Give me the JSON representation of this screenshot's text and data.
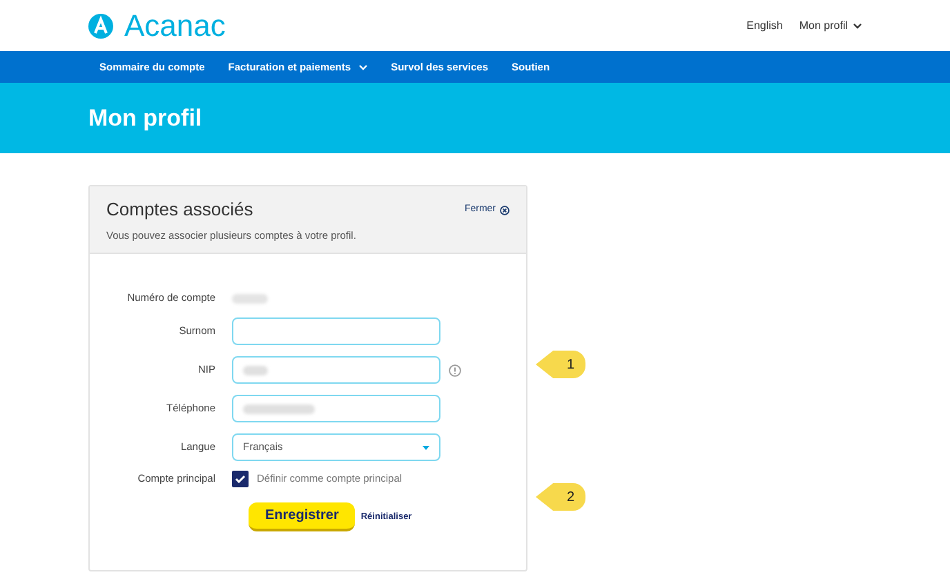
{
  "header": {
    "logo_text": "Acanac",
    "links": [
      "English",
      "Mon profil"
    ]
  },
  "nav": {
    "items": [
      {
        "label": "Sommaire du compte",
        "dropdown": false
      },
      {
        "label": "Facturation et paiements",
        "dropdown": true
      },
      {
        "label": "Survol des services",
        "dropdown": false
      },
      {
        "label": "Soutien",
        "dropdown": false
      }
    ]
  },
  "banner": {
    "title": "Mon profil"
  },
  "card": {
    "title": "Comptes associés",
    "subtitle": "Vous pouvez associer plusieurs comptes à votre profil.",
    "close_label": "Fermer",
    "fields": [
      {
        "kind": "static",
        "label": "Numéro de compte",
        "redacted": true
      },
      {
        "kind": "text",
        "label": "Surnom",
        "redacted": false,
        "info": false
      },
      {
        "kind": "text",
        "label": "NIP",
        "redacted": true,
        "info": true
      },
      {
        "kind": "text",
        "label": "Téléphone",
        "redacted": true,
        "info": false
      },
      {
        "kind": "select",
        "label": "Langue",
        "value": "Français"
      },
      {
        "kind": "checkbox",
        "label": "Compte principal",
        "option": "Définir comme compte principal",
        "checked": true
      }
    ],
    "save_button": "Enregistrer",
    "reset_link": "Réinitialiser"
  },
  "callouts": [
    {
      "number": "1"
    },
    {
      "number": "2"
    }
  ]
}
